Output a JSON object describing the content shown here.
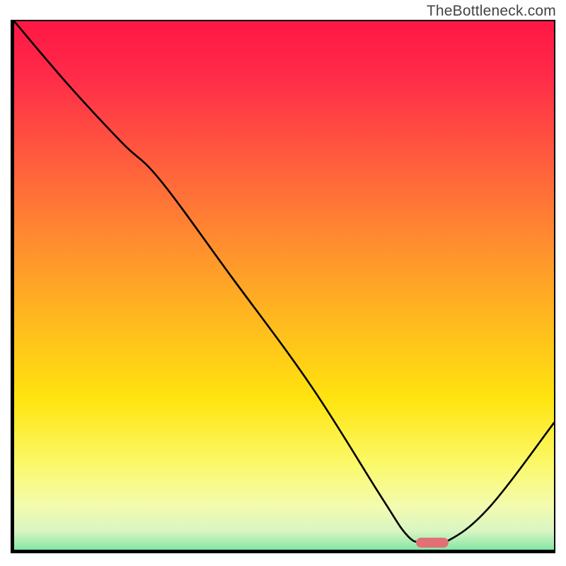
{
  "watermark": "TheBottleneck.com",
  "chart_data": {
    "type": "line",
    "title": "",
    "xlabel": "",
    "ylabel": "",
    "xlim": [
      0,
      100
    ],
    "ylim": [
      0,
      100
    ],
    "series": [
      {
        "name": "curve",
        "x": [
          0,
          10,
          20,
          27,
          40,
          55,
          68,
          73,
          76,
          80,
          88,
          100
        ],
        "y": [
          100,
          88,
          77,
          70,
          52,
          31,
          10,
          2.5,
          1.5,
          1.5,
          8,
          24
        ]
      }
    ],
    "marker": {
      "x": 77.5,
      "y": 1.4,
      "color": "#e36f76"
    },
    "background_gradient": {
      "stops": [
        {
          "offset": 0.0,
          "color": "#ff1744"
        },
        {
          "offset": 0.1,
          "color": "#ff2b49"
        },
        {
          "offset": 0.25,
          "color": "#ff5a3e"
        },
        {
          "offset": 0.4,
          "color": "#ff8a30"
        },
        {
          "offset": 0.55,
          "color": "#ffb81f"
        },
        {
          "offset": 0.7,
          "color": "#ffe40f"
        },
        {
          "offset": 0.82,
          "color": "#fbf96a"
        },
        {
          "offset": 0.9,
          "color": "#f3fbb0"
        },
        {
          "offset": 0.945,
          "color": "#d8f5c2"
        },
        {
          "offset": 0.975,
          "color": "#8ee8a9"
        },
        {
          "offset": 1.0,
          "color": "#28d07c"
        }
      ]
    }
  }
}
